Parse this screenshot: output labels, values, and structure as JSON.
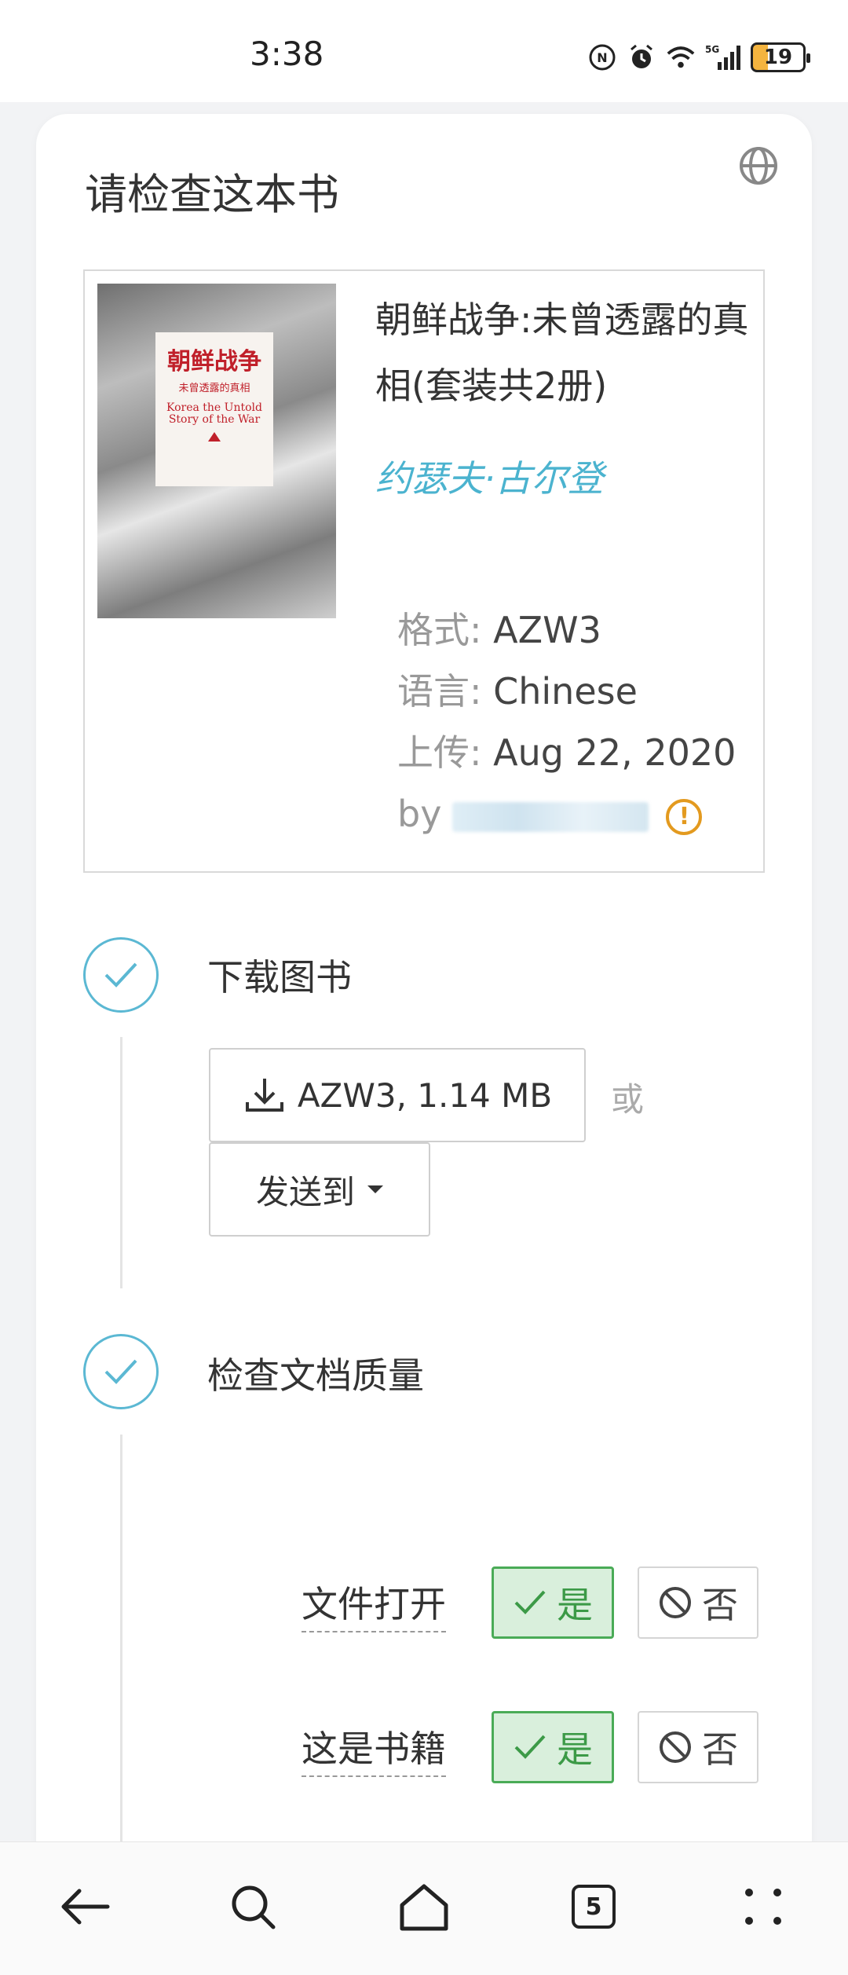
{
  "status_bar": {
    "time": "3:38",
    "battery": "19",
    "network": "5G"
  },
  "card": {
    "title": "请检查这本书",
    "globe_icon": "globe-icon"
  },
  "book": {
    "cover": {
      "title_cn": "朝鲜战争",
      "subtitle_cn": "未曾透露的真相",
      "title_en": "Korea the Untold Story of the War"
    },
    "title": "朝鲜战争:未曾透露的真相(套装共2册)",
    "author": "约瑟夫·古尔登",
    "meta": {
      "format_label": "格式:",
      "format_value": "AZW3",
      "language_label": "语言:",
      "language_value": "Chinese",
      "upload_label": "上传:",
      "upload_value": "Aug 22, 2020",
      "by_label": "by"
    }
  },
  "step_download": {
    "title": "下载图书",
    "download_button": "AZW3, 1.14 MB",
    "or_text": "或",
    "send_button": "发送到"
  },
  "step_quality": {
    "title": "检查文档质量",
    "questions": [
      {
        "label": "文件打开",
        "yes": "是",
        "no": "否"
      },
      {
        "label": "这是书籍",
        "yes": "是",
        "no": "否"
      }
    ]
  },
  "bottom_nav": {
    "tabs_count": "5"
  },
  "colors": {
    "accent": "#5bb8d3",
    "author": "#4bb3cf",
    "yes_bg": "#d9efdc",
    "yes_border": "#4aab57",
    "warning": "#e39a1f"
  }
}
